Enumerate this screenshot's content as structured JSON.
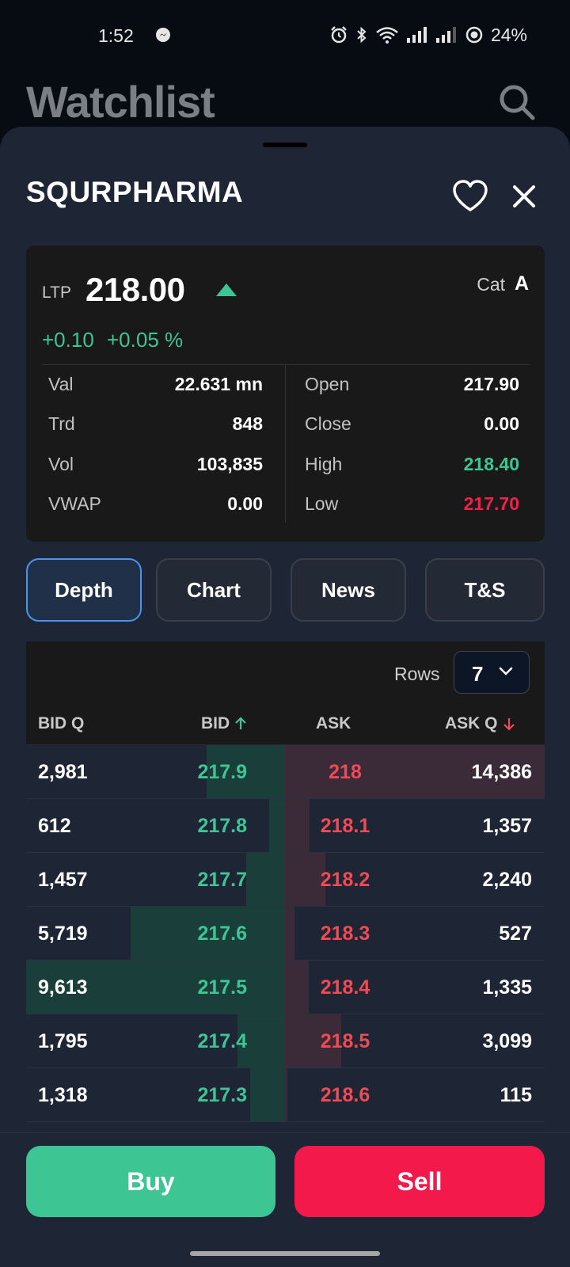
{
  "status_bar": {
    "time": "1:52",
    "battery": "24%",
    "icons": [
      "messenger-icon",
      "alarm-icon",
      "bluetooth-icon",
      "wifi-icon",
      "signal-icon",
      "signal-icon",
      "battery-saver-icon"
    ]
  },
  "background": {
    "title": "Watchlist",
    "search_icon": "search-icon"
  },
  "sheet": {
    "symbol": "SQURPHARMA",
    "favorite_icon": "heart-icon",
    "close_icon": "close-icon"
  },
  "quote": {
    "ltp_label": "LTP",
    "ltp_value": "218.00",
    "trend_icon": "triangle-up-icon",
    "cat_label": "Cat",
    "cat_value": "A",
    "change": "+0.10",
    "change_pct": "+0.05 %",
    "left_stats": [
      {
        "label": "Val",
        "value": "22.631 mn"
      },
      {
        "label": "Trd",
        "value": "848"
      },
      {
        "label": "Vol",
        "value": "103,835"
      },
      {
        "label": "VWAP",
        "value": "0.00"
      }
    ],
    "right_stats": [
      {
        "label": "Open",
        "value": "217.90"
      },
      {
        "label": "Close",
        "value": "0.00"
      },
      {
        "label": "High",
        "value": "218.40"
      },
      {
        "label": "Low",
        "value": "217.70"
      }
    ]
  },
  "tabs": [
    {
      "label": "Depth",
      "active": true
    },
    {
      "label": "Chart",
      "active": false
    },
    {
      "label": "News",
      "active": false
    },
    {
      "label": "T&S",
      "active": false
    }
  ],
  "depth": {
    "rows_label": "Rows",
    "rows_value": "7",
    "headers": {
      "bid_q": "BID Q",
      "bid": "BID",
      "ask": "ASK",
      "ask_q": "ASK Q"
    },
    "colors": {
      "bid": "#3dc593",
      "ask": "#f04a55"
    },
    "rows": [
      {
        "bid_q": "2,981",
        "bid": "217.9",
        "ask": "218",
        "ask_q": "14,386"
      },
      {
        "bid_q": "612",
        "bid": "217.8",
        "ask": "218.1",
        "ask_q": "1,357"
      },
      {
        "bid_q": "1,457",
        "bid": "217.7",
        "ask": "218.2",
        "ask_q": "2,240"
      },
      {
        "bid_q": "5,719",
        "bid": "217.6",
        "ask": "218.3",
        "ask_q": "527"
      },
      {
        "bid_q": "9,613",
        "bid": "217.5",
        "ask": "218.4",
        "ask_q": "1,335"
      },
      {
        "bid_q": "1,795",
        "bid": "217.4",
        "ask": "218.5",
        "ask_q": "3,099"
      },
      {
        "bid_q": "1,318",
        "bid": "217.3",
        "ask": "218.6",
        "ask_q": "115"
      }
    ]
  },
  "actions": {
    "buy": "Buy",
    "sell": "Sell",
    "buy_color": "#3dc593",
    "sell_color": "#f3194a"
  }
}
